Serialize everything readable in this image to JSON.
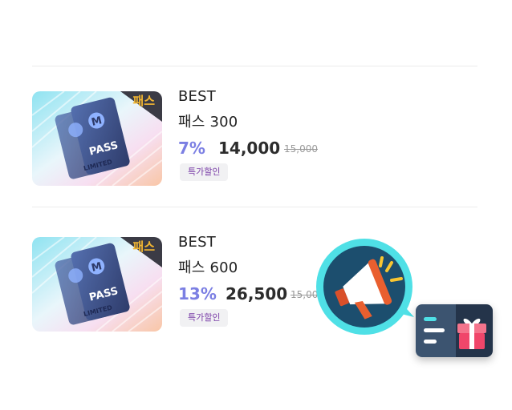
{
  "products": [
    {
      "thumb_label": "패스",
      "ticket_text": "PASS",
      "ticket_sub": "LIMITED",
      "badge": "BEST",
      "name": "패스 300",
      "discount": "7%",
      "price": "14,000",
      "original_price": "15,000",
      "tag": "특가할인"
    },
    {
      "thumb_label": "패스",
      "ticket_text": "PASS",
      "ticket_sub": "LIMITED",
      "badge": "BEST",
      "name": "패스 600",
      "discount": "13%",
      "price": "26,500",
      "original_price": "15,000",
      "tag": "특가할인"
    }
  ],
  "colors": {
    "discount": "#7b7fe3",
    "tag_text": "#7a3ea8",
    "badge_ring": "#4fe0e6",
    "badge_bg": "#1c4e6e",
    "gift_box": "#f0466a"
  },
  "icons": {
    "announcement": "megaphone-icon",
    "gift": "gift-icon"
  }
}
